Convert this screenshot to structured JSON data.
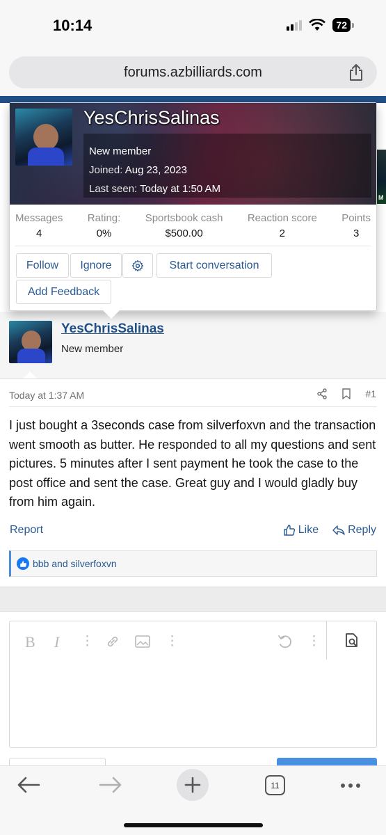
{
  "status_bar": {
    "time": "10:14",
    "battery": "72"
  },
  "browser": {
    "url": "forums.azbilliards.com",
    "tab_count": "11"
  },
  "banner_edge_text": "M",
  "member_card": {
    "username": "YesChrisSalinas",
    "user_title": "New member",
    "joined_label": "Joined:",
    "joined_value": "Aug 23, 2023",
    "last_seen_label": "Last seen:",
    "last_seen_value": "Today at 1:50 AM",
    "stats": [
      {
        "label": "Messages",
        "value": "4"
      },
      {
        "label": "Rating:",
        "value": "0%"
      },
      {
        "label": "Sportsbook cash",
        "value": "$500.00"
      },
      {
        "label": "Reaction score",
        "value": "2"
      },
      {
        "label": "Points",
        "value": "3"
      }
    ],
    "buttons": {
      "follow": "Follow",
      "ignore": "Ignore",
      "start_conversation": "Start conversation",
      "add_feedback": "Add Feedback"
    }
  },
  "post": {
    "username": "YesChrisSalinas",
    "user_title": "New member",
    "timestamp": "Today at 1:37 AM",
    "post_number": "#1",
    "body": "I just bought a 3seconds case from silverfoxvn and the transaction went smooth as butter. He responded to all my questions and sent pictures. 5 minutes after I sent payment he took the case to the post office and sent the case. Great guy and I would gladly buy from him again.",
    "report_label": "Report",
    "like_label": "Like",
    "reply_label": "Reply",
    "reactions_text": "bbb and silverfoxvn"
  },
  "colors": {
    "link": "#2a5a94",
    "header": "#1f4f86",
    "like": "#1877f2"
  }
}
